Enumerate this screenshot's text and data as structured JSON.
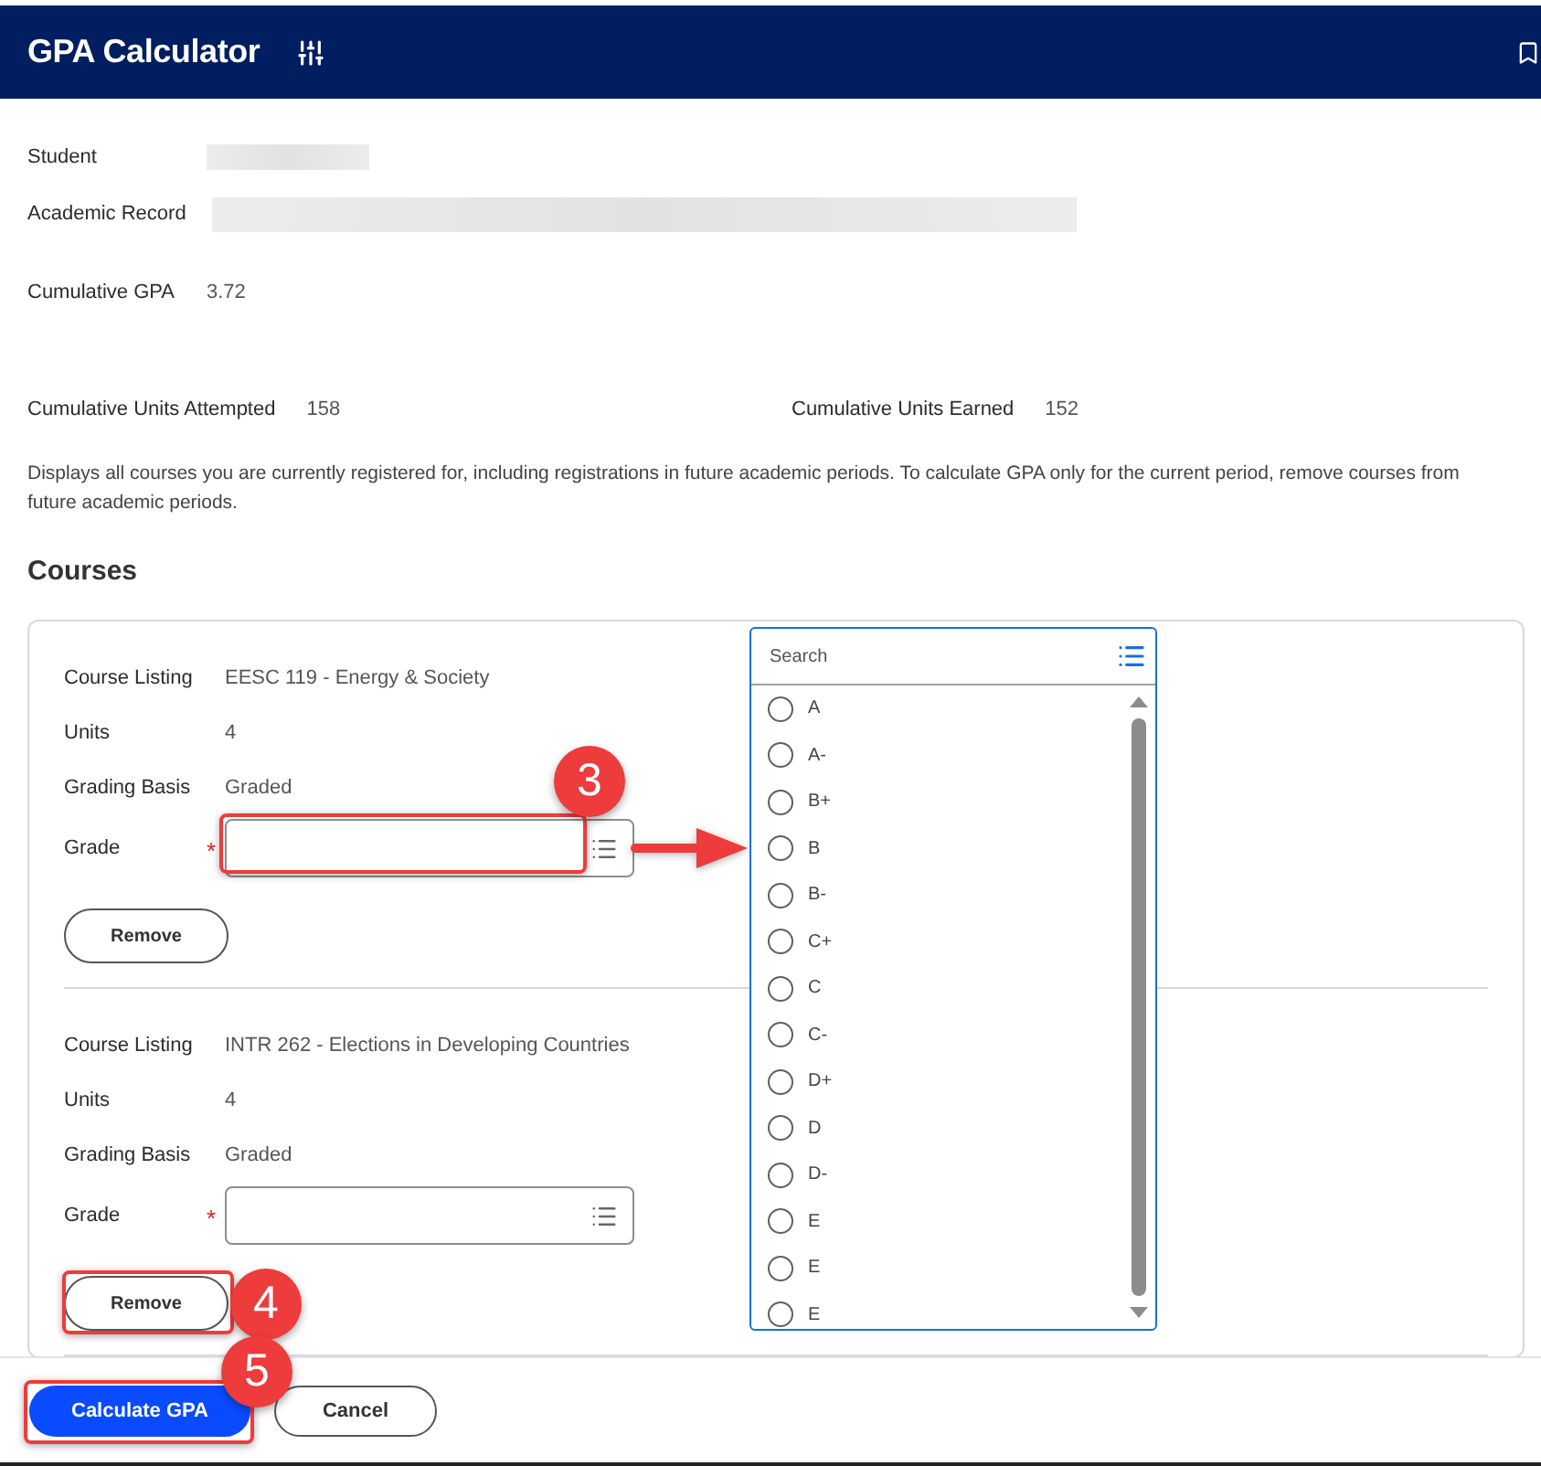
{
  "header": {
    "title": "GPA Calculator"
  },
  "summary": [
    {
      "label": "Student",
      "kind": "redacted"
    },
    {
      "label": "Academic Record",
      "kind": "redacted"
    },
    {
      "label": "Cumulative GPA",
      "kind": "text",
      "value": "3.72"
    }
  ],
  "units": [
    {
      "label": "Cumulative Units Attempted",
      "value": "158"
    },
    {
      "label": "Cumulative Units Earned",
      "value": "152"
    }
  ],
  "description": "Displays all courses you are currently registered for, including registrations in future academic periods. To calculate GPA only for the current period, remove courses from future academic periods.",
  "courses_section": {
    "heading": "Courses",
    "courses": [
      {
        "details": [
          {
            "label": "Course Listing",
            "value": "EESC 119 - Energy & Society"
          },
          {
            "label": "Units",
            "value": "4"
          },
          {
            "label": "Grading Basis",
            "value": "Graded"
          }
        ],
        "grade": {
          "label": "Grade",
          "required_mark": "*",
          "callout": "3",
          "arrow": true
        },
        "remove": {
          "label": "Remove"
        }
      },
      {
        "details": [
          {
            "label": "Course Listing",
            "value": "INTR 262 - Elections in Developing Countries"
          },
          {
            "label": "Units",
            "value": "4"
          },
          {
            "label": "Grading Basis",
            "value": "Graded"
          }
        ],
        "grade": {
          "label": "Grade",
          "required_mark": "*"
        },
        "remove": {
          "label": "Remove",
          "callout": "4"
        }
      }
    ]
  },
  "dropdown": {
    "placeholder": "Search",
    "options": [
      {
        "label": "A",
        "selected": false
      },
      {
        "label": "A-",
        "selected": false
      },
      {
        "label": "B+",
        "selected": false
      },
      {
        "label": "B",
        "selected": false
      },
      {
        "label": "B-",
        "selected": false
      },
      {
        "label": "C+",
        "selected": false
      },
      {
        "label": "C",
        "selected": false
      },
      {
        "label": "C-",
        "selected": false
      },
      {
        "label": "D+",
        "selected": false
      },
      {
        "label": "D",
        "selected": false
      },
      {
        "label": "D-",
        "selected": false
      },
      {
        "label": "E",
        "selected": false
      },
      {
        "label": "E",
        "selected": false
      },
      {
        "label": "E",
        "selected": false
      }
    ]
  },
  "footer": {
    "buttons": [
      {
        "label": "Calculate GPA",
        "kind": "primary",
        "callout": "5"
      },
      {
        "label": "Cancel",
        "kind": "secondary"
      }
    ]
  }
}
